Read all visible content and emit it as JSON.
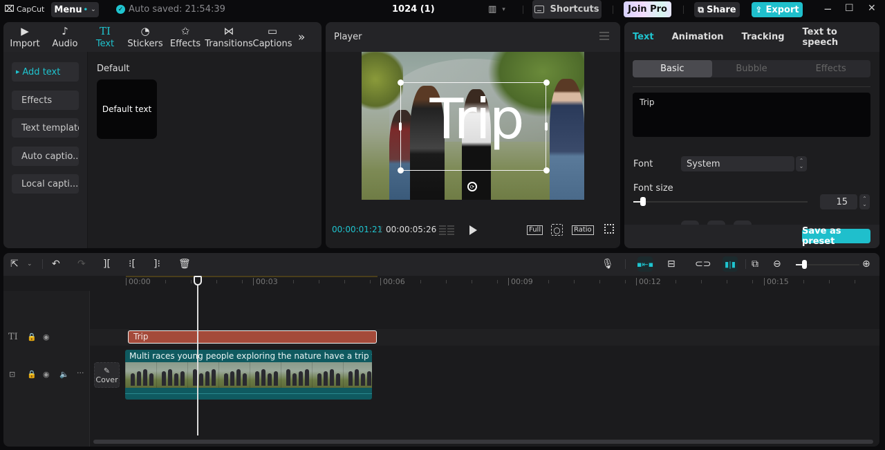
{
  "titlebar": {
    "app_name": "CapCut",
    "menu_label": "Menu",
    "autosave_text": "Auto saved: 21:54:39",
    "project_title": "1024 (1)",
    "shortcuts_label": "Shortcuts",
    "join_pro_label": "Join Pro",
    "share_label": "Share",
    "export_label": "Export",
    "minimize": "−",
    "maximize": "☐",
    "close": "✕"
  },
  "media_tabs": [
    {
      "label": "Import",
      "icon": "▶"
    },
    {
      "label": "Audio",
      "icon": "♪"
    },
    {
      "label": "Text",
      "icon": "TI"
    },
    {
      "label": "Stickers",
      "icon": "◔"
    },
    {
      "label": "Effects",
      "icon": "✩"
    },
    {
      "label": "Transitions",
      "icon": "⋈"
    },
    {
      "label": "Captions",
      "icon": "▭"
    }
  ],
  "more_tabs": "»",
  "text_sidebar": [
    {
      "label": "Add text"
    },
    {
      "label": "Effects"
    },
    {
      "label": "Text template"
    },
    {
      "label": "Auto captio..."
    },
    {
      "label": "Local capti..."
    }
  ],
  "presets": {
    "section_label": "Default",
    "card_label": "Default text"
  },
  "player": {
    "title": "Player",
    "overlay_text": "Trip",
    "current_time": "00:00:01:21",
    "separator": "/",
    "total_time": "00:00:05:26",
    "full_label": "Full",
    "ratio_label": "Ratio"
  },
  "inspector": {
    "tabs": [
      {
        "label": "Text"
      },
      {
        "label": "Animation"
      },
      {
        "label": "Tracking"
      },
      {
        "label": "Text to speech"
      }
    ],
    "subtabs": [
      {
        "label": "Basic"
      },
      {
        "label": "Bubble"
      },
      {
        "label": "Effects"
      }
    ],
    "text_value": "Trip",
    "font_label": "Font",
    "font_value": "System",
    "font_size_label": "Font size",
    "font_size_value": "15",
    "font_size_slider_fraction": 0.04,
    "save_preset_label": "Save as preset"
  },
  "timeline": {
    "ruler_labels": [
      "00:00",
      "00:03",
      "00:06",
      "00:09",
      "00:12",
      "00:15"
    ],
    "text_clip_label": "Trip",
    "video_clip_title": "Multi races young people exploring the nature have a trip togethe",
    "cover_label": "Cover",
    "zoom_fraction": 0.1
  },
  "colors": {
    "accent": "#1fc4cf",
    "text_clip": "#a44a3a",
    "video_clip": "#0f5a60"
  }
}
